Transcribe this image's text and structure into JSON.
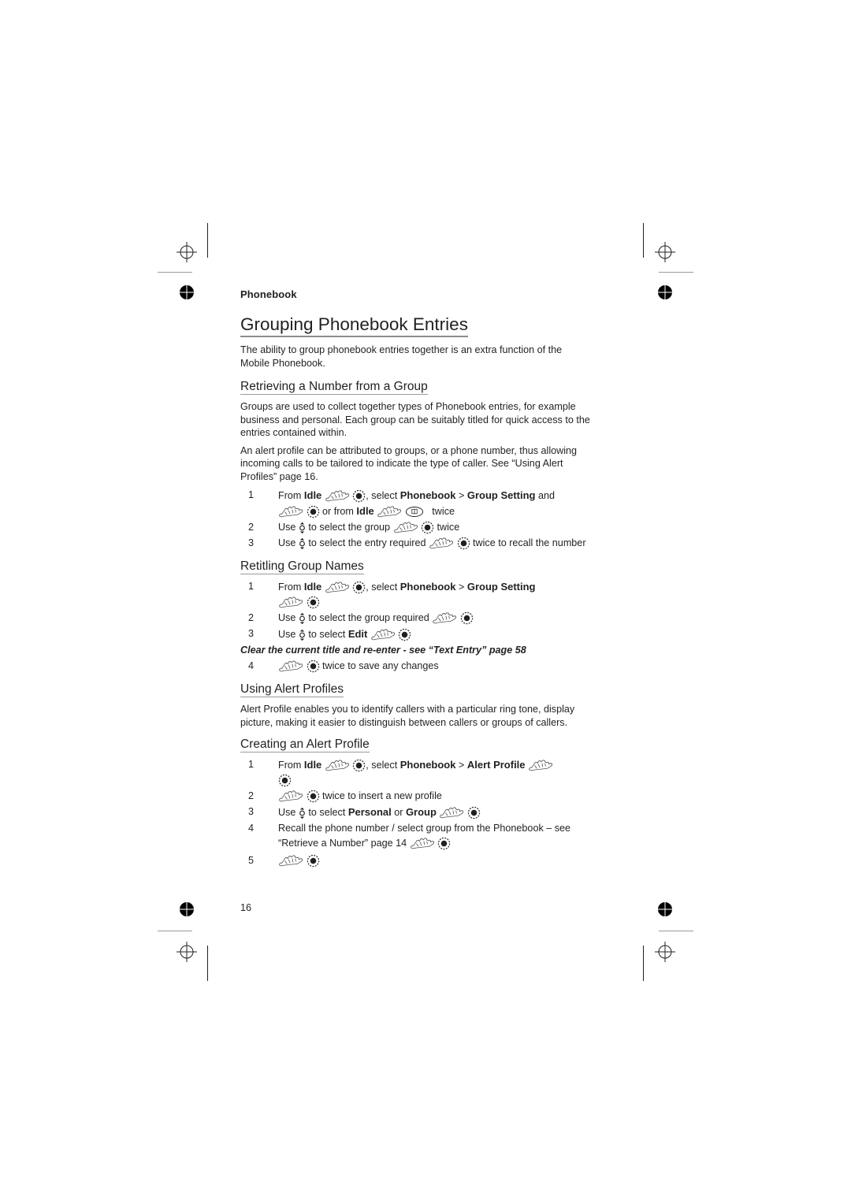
{
  "page": {
    "running_head": "Phonebook",
    "page_number": "16"
  },
  "title": "Grouping Phonebook Entries",
  "intro": "The ability to group phonebook entries together is an extra function of the Mobile Phonebook.",
  "sections": {
    "retrieving": {
      "heading": "Retrieving a Number from a Group",
      "para1": "Groups are used to collect together types of Phonebook entries, for example business and personal. Each group can be suitably titled for quick access to the entries contained within.",
      "para2": "An alert profile can be attributed to groups, or a phone number, thus allowing incoming calls to be tailored to indicate the type of caller. See “Using Alert Profiles” page 16.",
      "steps": [
        {
          "num": "1",
          "t1": "From ",
          "b1": "Idle",
          "t2": ", select ",
          "b2": "Phonebook",
          "t3": " > ",
          "b3": "Group Setting",
          "t4": " and",
          "t5": " or from ",
          "b4": "Idle",
          "t6": " twice"
        },
        {
          "num": "2",
          "t1": "Use ",
          "t2": " to select the group ",
          "t3": " twice"
        },
        {
          "num": "3",
          "t1": "Use ",
          "t2": " to select the entry required ",
          "t3": " twice to recall the number"
        }
      ]
    },
    "retitling": {
      "heading": "Retitling Group Names",
      "steps": [
        {
          "num": "1",
          "t1": "From ",
          "b1": "Idle",
          "t2": ", select ",
          "b2": "Phonebook",
          "t3": " > ",
          "b3": "Group Setting"
        },
        {
          "num": "2",
          "t1": "Use ",
          "t2": " to select the group required "
        },
        {
          "num": "3",
          "t1": "Use ",
          "t2": " to select ",
          "b1": "Edit"
        },
        {
          "num": "4",
          "t1": " twice to save any changes"
        }
      ],
      "note": "Clear the current title and re-enter - see “Text Entry” page 58"
    },
    "using_alert": {
      "heading": "Using Alert Profiles",
      "para": "Alert Profile enables you to identify callers with a particular ring tone, display picture, making it easier to distinguish between callers or groups of callers."
    },
    "creating_alert": {
      "heading": "Creating an Alert Profile",
      "steps": [
        {
          "num": "1",
          "t1": "From ",
          "b1": "Idle",
          "t2": ", select ",
          "b2": "Phonebook",
          "t3": " > ",
          "b3": "Alert Profile"
        },
        {
          "num": "2",
          "t1": " twice to insert a new profile"
        },
        {
          "num": "3",
          "t1": "Use ",
          "t2": " to select ",
          "b1": "Personal",
          "t3": " or ",
          "b2": "Group"
        },
        {
          "num": "4",
          "t1": "Recall the phone number / select group from the Phonebook – see “Retrieve a Number” page 14 "
        },
        {
          "num": "5"
        }
      ]
    }
  },
  "icons": {
    "hand": "hand-press-icon",
    "ok": "ok-key-icon",
    "nav": "nav-up-down-icon",
    "phonebook_key": "phonebook-key-icon"
  }
}
